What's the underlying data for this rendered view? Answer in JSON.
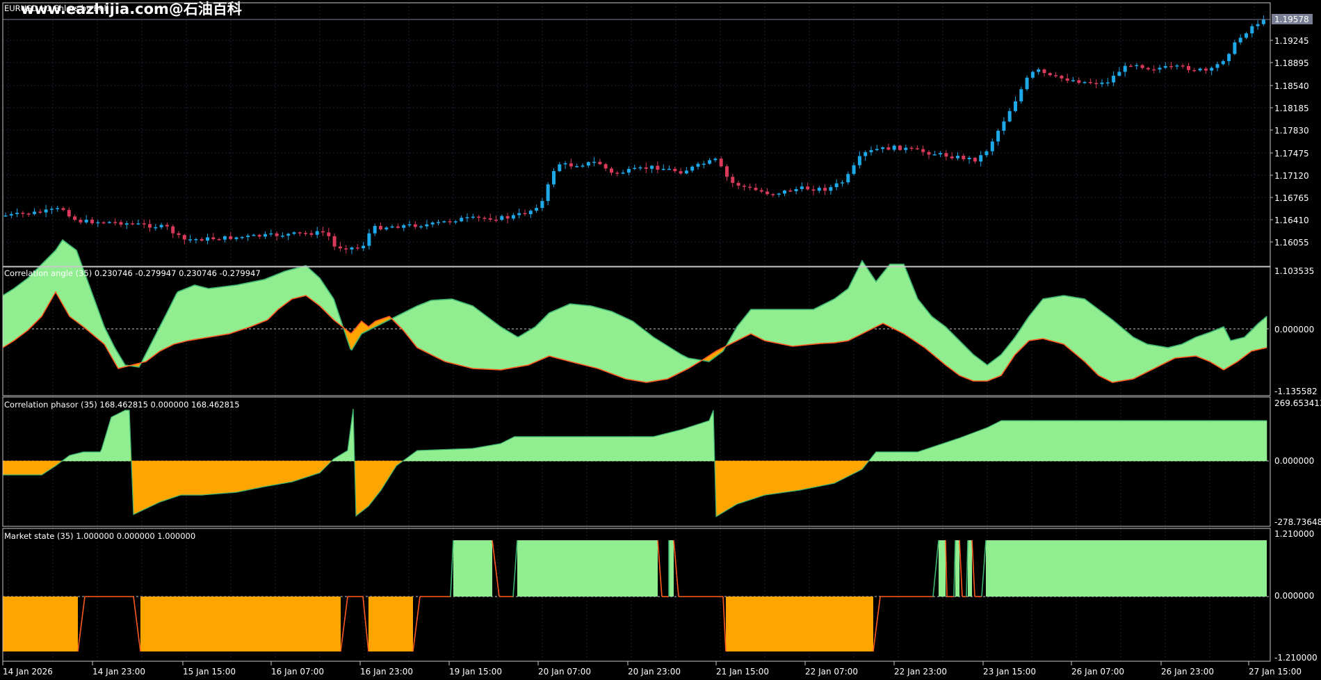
{
  "watermark": "www.eazhijia.com@石油百科",
  "symbol_title": "EURUSD,H1 Ehlers by Bell",
  "current_price": "1.19578",
  "colors": {
    "background": "#000000",
    "grid": "#1e2233",
    "bull_candle": "#1ea8e8",
    "bear_candle": "#d93a5a",
    "orange": "#ffa500",
    "green": "#90ee90",
    "orange_line": "#ff5a1e",
    "green_line": "#3cb371",
    "price_line": "#7a7f95"
  },
  "price_panel": {
    "y_ticks": [
      "1.19245",
      "1.18895",
      "1.18540",
      "1.18185",
      "1.17830",
      "1.17475",
      "1.17120",
      "1.16765",
      "1.16410",
      "1.16055"
    ]
  },
  "indicator_panels": [
    {
      "title": "Correlation angle (35) 0.230746 -0.279947 0.230746 -0.279947",
      "y_max_label": "1.103535",
      "y_mid_label": "0.000000",
      "y_min_label": "-1.135582"
    },
    {
      "title": "Correlation phasor (35) 168.462815 0.000000 168.462815",
      "y_max_label": "269.653413",
      "y_mid_label": "0.000000",
      "y_min_label": "-278.73648"
    },
    {
      "title": "Market state (35) 1.000000 0.000000 1.000000",
      "y_max_label": "1.210000",
      "y_mid_label": "0.000000",
      "y_min_label": "-1.210000"
    }
  ],
  "x_ticks": [
    "14 Jan 2026",
    "14 Jan 23:00",
    "15 Jan 15:00",
    "16 Jan 07:00",
    "16 Jan 23:00",
    "19 Jan 15:00",
    "20 Jan 07:00",
    "20 Jan 23:00",
    "21 Jan 15:00",
    "22 Jan 07:00",
    "22 Jan 23:00",
    "23 Jan 15:00",
    "26 Jan 07:00",
    "26 Jan 23:00",
    "27 Jan 15:00"
  ]
}
